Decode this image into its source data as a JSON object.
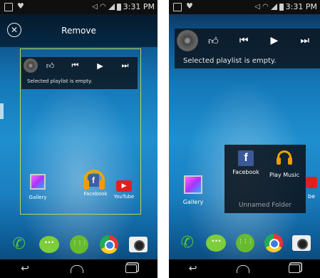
{
  "left_screen": {
    "status_time": "3:31 PM",
    "remove_bar": {
      "label": "Remove",
      "close_icon": "close-circle-icon"
    },
    "music_widget": {
      "message": "Selected playlist is empty."
    },
    "apps": [
      {
        "label": "Gallery",
        "icon": "gallery-icon"
      },
      {
        "label": "Facebook",
        "icon": "facebook-icon"
      },
      {
        "label": "YouTube",
        "icon": "youtube-icon"
      }
    ]
  },
  "right_screen": {
    "status_time": "3:31 PM",
    "music_widget": {
      "message": "Selected playlist is empty."
    },
    "gallery_label": "Gallery",
    "tube_fragment": "be",
    "folder": {
      "name": "Unnamed Folder",
      "apps": [
        {
          "label": "Facebook",
          "icon": "facebook-icon"
        },
        {
          "label": "Play Music",
          "icon": "play-music-icon"
        }
      ]
    }
  },
  "dock_icons": [
    "phone-icon",
    "messaging-icon",
    "apps-drawer-icon",
    "chrome-icon",
    "camera-icon"
  ],
  "nav_icons": [
    "back-icon",
    "home-icon",
    "recent-apps-icon"
  ],
  "colors": {
    "drop_frame": "#b7d84b",
    "accent_orange": "#f0a400",
    "facebook_blue": "#3b5998",
    "youtube_red": "#e02020"
  }
}
